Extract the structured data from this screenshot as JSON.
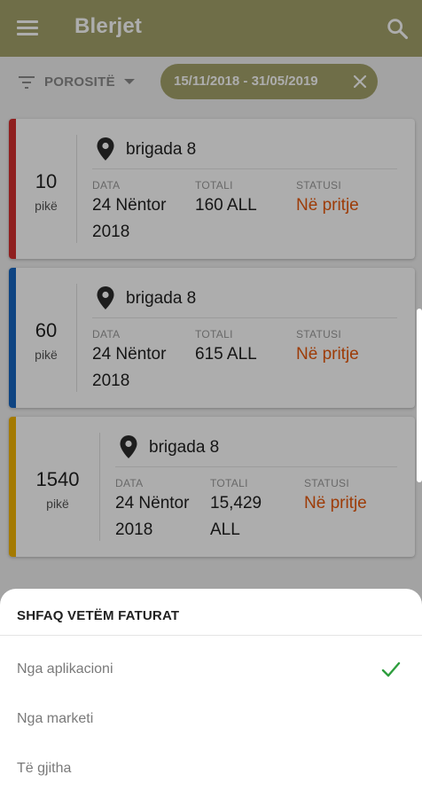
{
  "appbar": {
    "title": "Blerjet",
    "menu_icon": "hamburger-menu-icon",
    "search_icon": "search-icon"
  },
  "filter": {
    "label": "POROSITË",
    "date_range": "15/11/2018 - 31/05/2019"
  },
  "orders": [
    {
      "points": "10",
      "points_label": "pikë",
      "stripe_color": "#d32f2f",
      "store": "brigada 8",
      "date_label": "DATA",
      "date_l1": "24 Nëntor",
      "date_l2": "2018",
      "total_label": "TOTALI",
      "total_l1": "160 ALL",
      "total_l2": "",
      "status_label": "STATUSI",
      "status": "Në pritje"
    },
    {
      "points": "60",
      "points_label": "pikë",
      "stripe_color": "#1565c0",
      "store": "brigada 8",
      "date_label": "DATA",
      "date_l1": "24 Nëntor",
      "date_l2": "2018",
      "total_label": "TOTALI",
      "total_l1": "615 ALL",
      "total_l2": "",
      "status_label": "STATUSI",
      "status": "Në pritje"
    },
    {
      "points": "1540",
      "points_label": "pikë",
      "stripe_color": "#f2b400",
      "store": "brigada 8",
      "date_label": "DATA",
      "date_l1": "24 Nëntor",
      "date_l2": "2018",
      "total_label": "TOTALI",
      "total_l1": "15,429",
      "total_l2": "ALL",
      "status_label": "STATUSI",
      "status": "Në pritje"
    }
  ],
  "sheet": {
    "title": "SHFAQ VETËM FATURAT",
    "options": [
      {
        "label": "Nga aplikacioni",
        "selected": true
      },
      {
        "label": "Nga marketi",
        "selected": false
      },
      {
        "label": "Të gjitha",
        "selected": false
      }
    ]
  },
  "colors": {
    "primary": "#a4a26a",
    "status": "#e8590c",
    "check": "#2e9e3e"
  }
}
